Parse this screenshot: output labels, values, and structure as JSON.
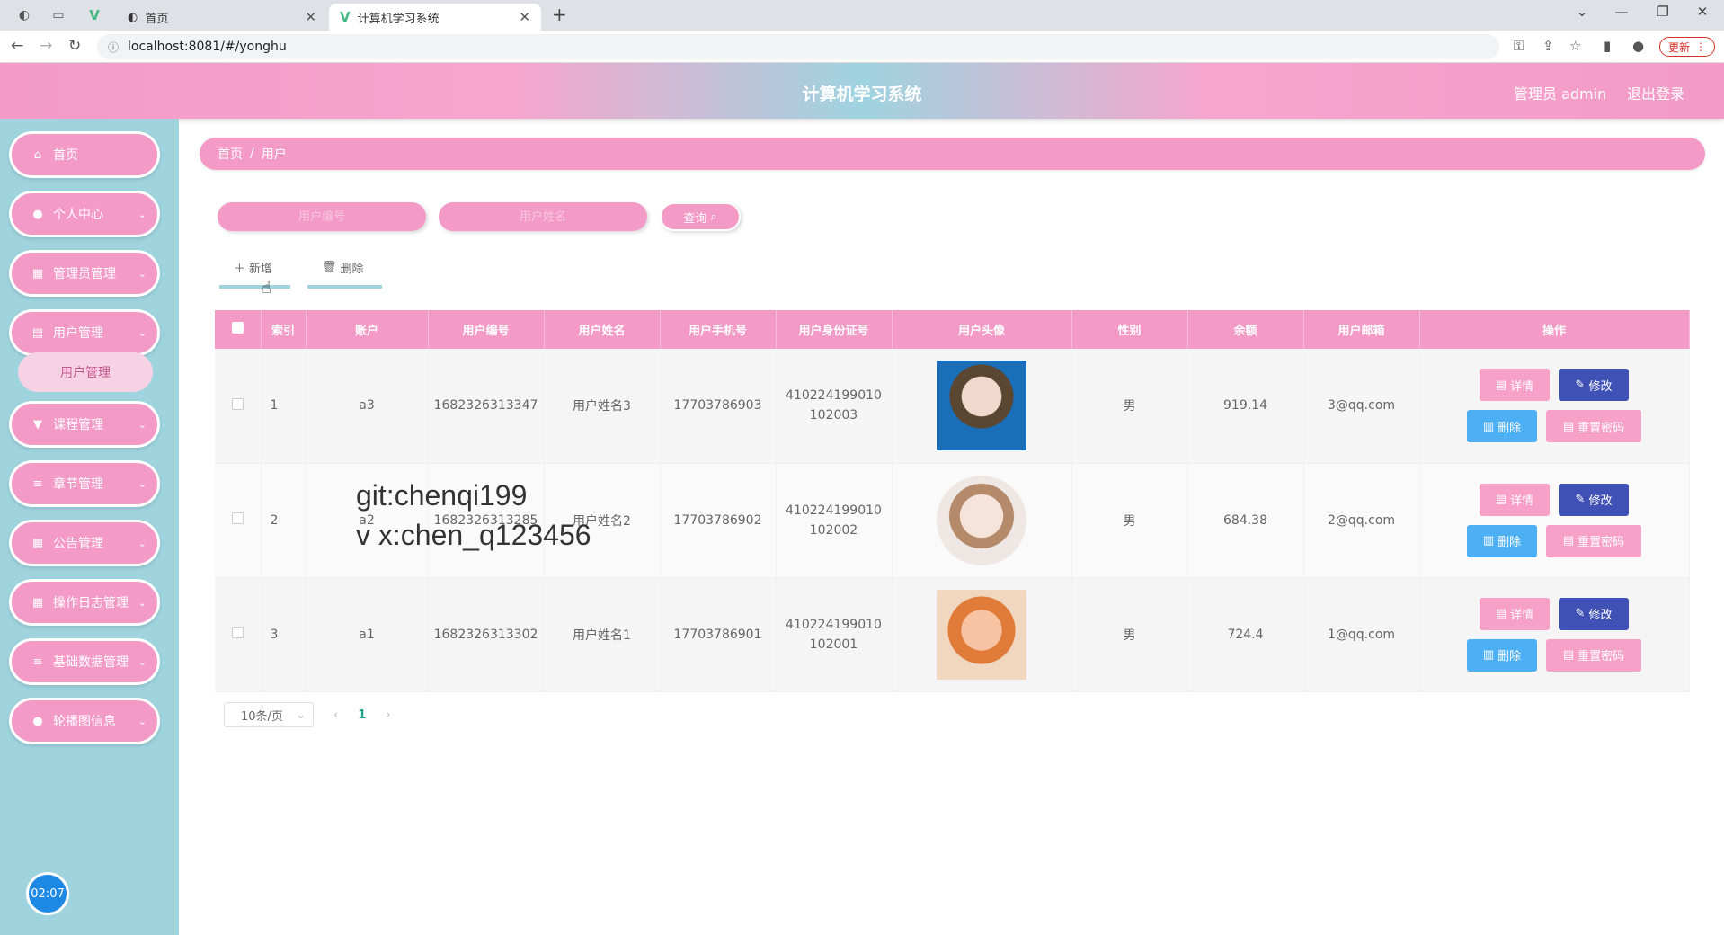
{
  "browser": {
    "tabs": [
      {
        "label": "首页",
        "active": false
      },
      {
        "label": "计算机学习系统",
        "active": true
      }
    ],
    "url": "localhost:8081/#/yonghu",
    "update_label": "更新"
  },
  "header": {
    "title": "计算机学习系统",
    "user": "管理员 admin",
    "logout": "退出登录"
  },
  "sidebar": {
    "items": [
      {
        "label": "首页",
        "icon": "home-icon"
      },
      {
        "label": "个人中心",
        "icon": "user-icon"
      },
      {
        "label": "管理员管理",
        "icon": "grid-icon"
      },
      {
        "label": "用户管理",
        "icon": "clipboard-icon"
      },
      {
        "label": "课程管理",
        "icon": "trophy-icon"
      },
      {
        "label": "章节管理",
        "icon": "menu-icon"
      },
      {
        "label": "公告管理",
        "icon": "grid-icon"
      },
      {
        "label": "操作日志管理",
        "icon": "grid-icon"
      },
      {
        "label": "基础数据管理",
        "icon": "menu-icon"
      },
      {
        "label": "轮播图信息",
        "icon": "bulb-icon"
      }
    ],
    "submenu_label": "用户管理",
    "timer": "02:07"
  },
  "breadcrumb": {
    "home": "首页",
    "sep": "/",
    "current": "用户"
  },
  "search": {
    "placeholder_code": "用户编号",
    "placeholder_name": "用户姓名",
    "button": "查询"
  },
  "actions": {
    "add": "新增",
    "delete": "删除"
  },
  "table": {
    "headers": [
      "",
      "索引",
      "账户",
      "用户编号",
      "用户姓名",
      "用户手机号",
      "用户身份证号",
      "用户头像",
      "性别",
      "余额",
      "用户邮箱",
      "操作"
    ],
    "rows": [
      {
        "index": "1",
        "account": "a3",
        "code": "1682326313347",
        "name": "用户姓名3",
        "phone": "17703786903",
        "idcard": "410224199010102003",
        "gender": "男",
        "balance": "919.14",
        "email": "3@qq.com"
      },
      {
        "index": "2",
        "account": "a2",
        "code": "1682326313285",
        "name": "用户姓名2",
        "phone": "17703786902",
        "idcard": "410224199010102002",
        "gender": "男",
        "balance": "684.38",
        "email": "2@qq.com"
      },
      {
        "index": "3",
        "account": "a1",
        "code": "1682326313302",
        "name": "用户姓名1",
        "phone": "17703786901",
        "idcard": "410224199010102001",
        "gender": "男",
        "balance": "724.4",
        "email": "1@qq.com"
      }
    ],
    "op_labels": {
      "detail": "详情",
      "edit": "修改",
      "delete": "删除",
      "reset": "重置密码"
    }
  },
  "pager": {
    "page_size": "10条/页",
    "current": "1"
  },
  "watermark": [
    "git:chenqi199",
    "v x:chen_q123456"
  ]
}
